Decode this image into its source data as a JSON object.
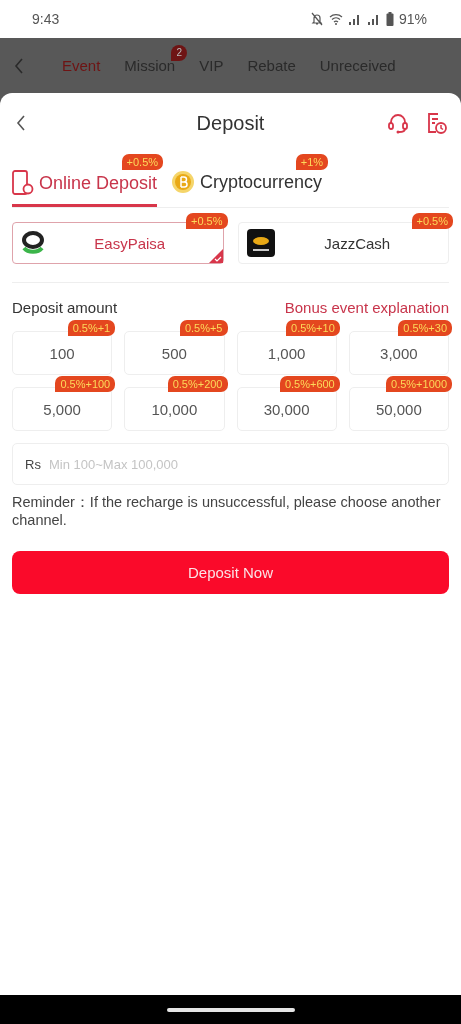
{
  "status_bar": {
    "time": "9:43",
    "battery": "91%"
  },
  "background_tabs": [
    {
      "label": "Event",
      "selected": true
    },
    {
      "label": "Mission",
      "selected": false,
      "badge": "2"
    },
    {
      "label": "VIP",
      "selected": false
    },
    {
      "label": "Rebate",
      "selected": false
    },
    {
      "label": "Unreceived",
      "selected": false
    }
  ],
  "sheet": {
    "title": "Deposit",
    "method_tabs": [
      {
        "label": "Online Deposit",
        "bonus": "+0.5%",
        "selected": true,
        "kind": "phone"
      },
      {
        "label": "Cryptocurrency",
        "bonus": "+1%",
        "selected": false,
        "kind": "coin"
      }
    ],
    "channels": [
      {
        "name": "EasyPaisa",
        "bonus": "+0.5%",
        "selected": true,
        "kind": "easypaisa"
      },
      {
        "name": "JazzCash",
        "bonus": "+0.5%",
        "selected": false,
        "kind": "jazzcash"
      }
    ],
    "amount_label": "Deposit amount",
    "bonus_link": "Bonus event explanation",
    "amounts": [
      {
        "value": "100",
        "bonus": "0.5%+1",
        "selected": false
      },
      {
        "value": "500",
        "bonus": "0.5%+5",
        "selected": false
      },
      {
        "value": "1,000",
        "bonus": "0.5%+10",
        "selected": false
      },
      {
        "value": "3,000",
        "bonus": "0.5%+30",
        "selected": false
      },
      {
        "value": "5,000",
        "bonus": "0.5%+100",
        "selected": false
      },
      {
        "value": "10,000",
        "bonus": "0.5%+200",
        "selected": false
      },
      {
        "value": "30,000",
        "bonus": "0.5%+600",
        "selected": false
      },
      {
        "value": "50,000",
        "bonus": "0.5%+1000",
        "selected": false
      }
    ],
    "amount_field": {
      "currency": "Rs",
      "placeholder": "Min 100~Max 100,000"
    },
    "reminder": "Reminder：If the recharge is unsuccessful, please choose another channel.",
    "submit": "Deposit Now"
  }
}
